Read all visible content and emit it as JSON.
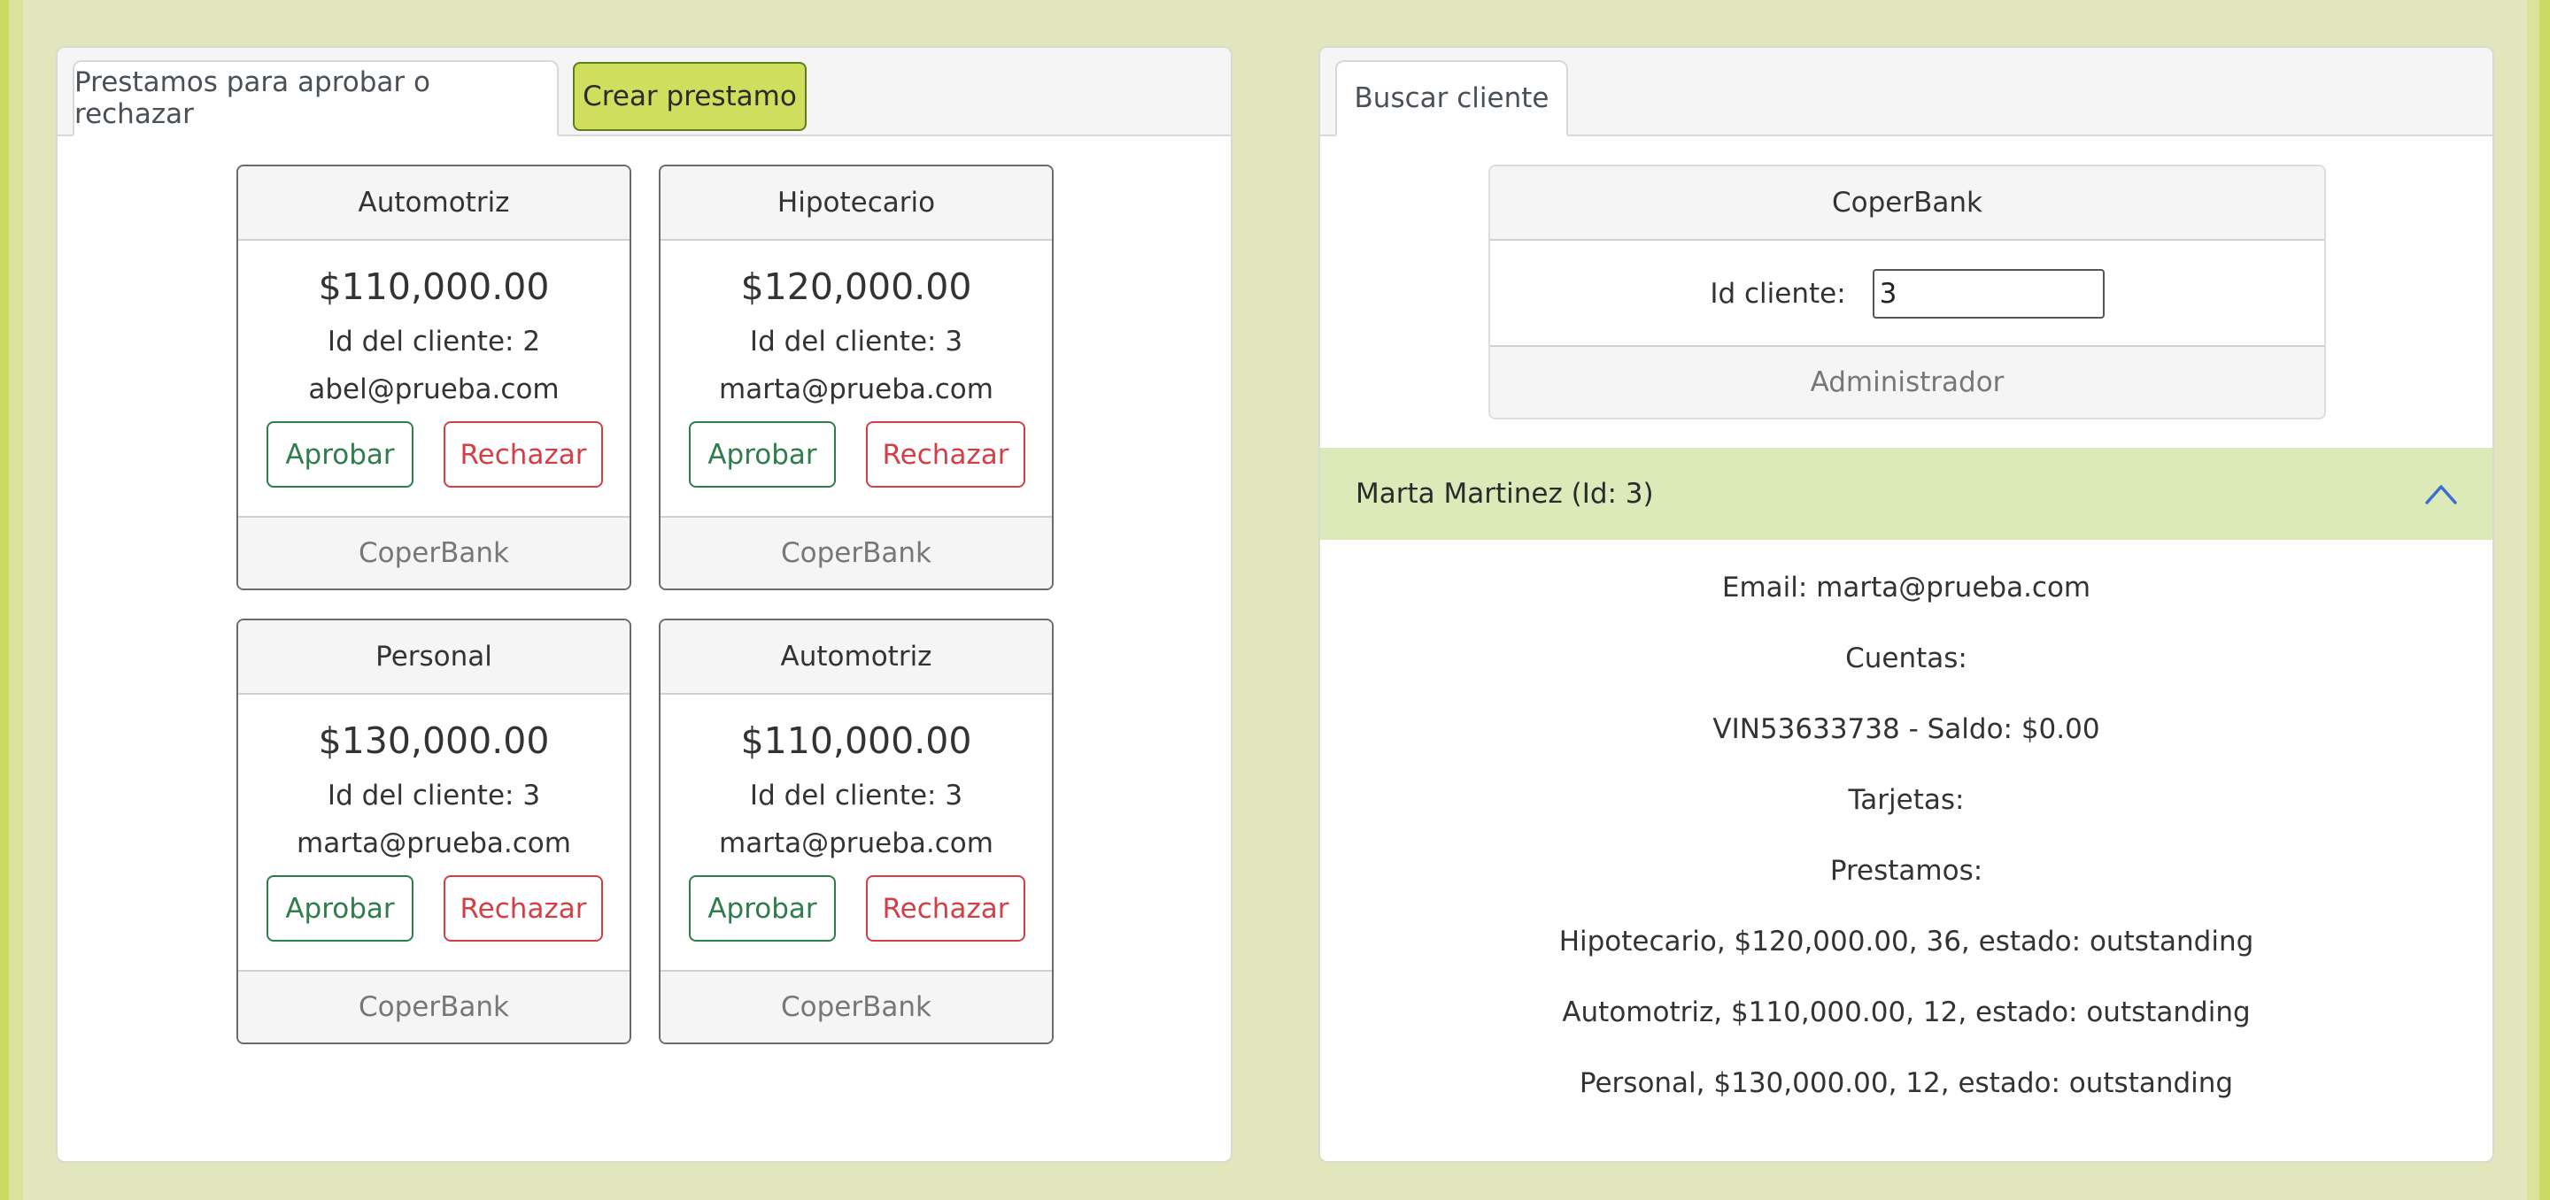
{
  "left_panel": {
    "tab_label": "Prestamos para aprobar o rechazar",
    "create_button": "Crear prestamo",
    "loans": [
      {
        "type": "Automotriz",
        "amount": "$110,000.00",
        "client_id": "Id del cliente: 2",
        "email": "abel@prueba.com",
        "approve": "Aprobar",
        "reject": "Rechazar",
        "footer": "CoperBank"
      },
      {
        "type": "Hipotecario",
        "amount": "$120,000.00",
        "client_id": "Id del cliente: 3",
        "email": "marta@prueba.com",
        "approve": "Aprobar",
        "reject": "Rechazar",
        "footer": "CoperBank"
      },
      {
        "type": "Personal",
        "amount": "$130,000.00",
        "client_id": "Id del cliente: 3",
        "email": "marta@prueba.com",
        "approve": "Aprobar",
        "reject": "Rechazar",
        "footer": "CoperBank"
      },
      {
        "type": "Automotriz",
        "amount": "$110,000.00",
        "client_id": "Id del cliente: 3",
        "email": "marta@prueba.com",
        "approve": "Aprobar",
        "reject": "Rechazar",
        "footer": "CoperBank"
      }
    ]
  },
  "right_panel": {
    "tab_label": "Buscar cliente",
    "search_card": {
      "header": "CoperBank",
      "label": "Id cliente:",
      "value": "3",
      "footer": "Administrador"
    },
    "client": {
      "title": "Marta Martinez (Id: 3)",
      "expanded_icon": "chevron-up-icon",
      "email": "Email: marta@prueba.com",
      "accounts_label": "Cuentas:",
      "account": "VIN53633738 - Saldo: $0.00",
      "cards_label": "Tarjetas:",
      "loans_label": "Prestamos:",
      "loans": [
        "Hipotecario, $120,000.00, 36, estado: outstanding",
        "Automotriz, $110,000.00, 12, estado: outstanding",
        "Personal, $130,000.00, 12, estado: outstanding"
      ]
    }
  },
  "colors": {
    "background": "#e2e6bd",
    "accent": "#cfde5c",
    "approve": "#2e7d4a",
    "reject": "#d43f47",
    "accordion": "#dbeab8",
    "chevron": "#3b6fd1"
  }
}
